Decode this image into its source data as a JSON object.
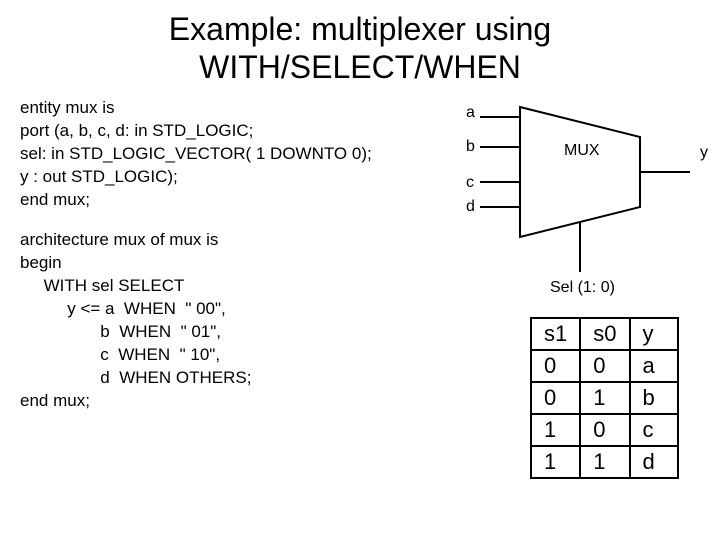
{
  "title_line1": "Example: multiplexer using",
  "title_line2": "WITH/SELECT/WHEN",
  "entity_code": "entity mux is\nport (a, b, c, d: in STD_LOGIC;\nsel: in STD_LOGIC_VECTOR( 1 DOWNTO 0);\ny : out STD_LOGIC);\nend mux;",
  "arch_code": "architecture mux of mux is\nbegin\n     WITH sel SELECT\n          y <= a  WHEN  \" 00\",\n                 b  WHEN  \" 01\",\n                 c  WHEN  \" 10\",\n                 d  WHEN OTHERS;\nend mux;",
  "diagram": {
    "inputs": [
      "a",
      "b",
      "c",
      "d"
    ],
    "block_label": "MUX",
    "output": "y",
    "sel_label": "Sel (1: 0)"
  },
  "truth_table": {
    "header": [
      "s1",
      "s0",
      "y"
    ],
    "rows": [
      [
        "0",
        "0",
        "a"
      ],
      [
        "0",
        "1",
        "b"
      ],
      [
        "1",
        "0",
        "c"
      ],
      [
        "1",
        "1",
        "d"
      ]
    ]
  }
}
